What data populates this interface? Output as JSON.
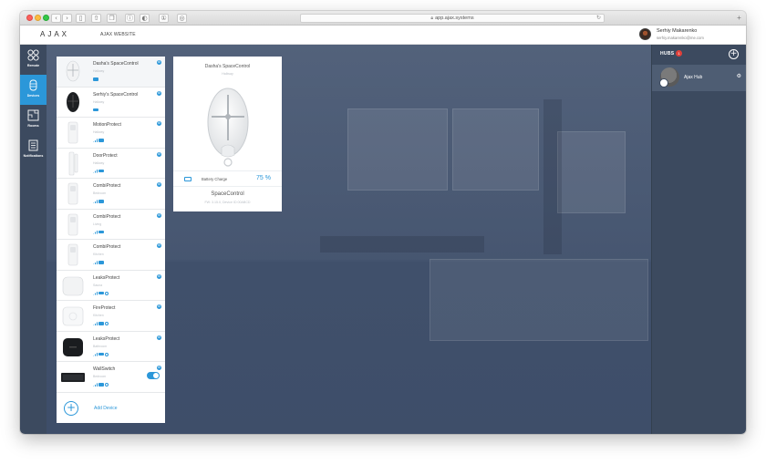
{
  "browser": {
    "url": "app.ajax.systems"
  },
  "header": {
    "logo": "AJAX",
    "website_link": "AJAX WEBSITE",
    "user_name": "Serhiy Makarenko",
    "user_email": "serhiy.makarenko@me.com"
  },
  "sidebar": {
    "items": [
      {
        "label": "Remote",
        "icon": "remote-icon"
      },
      {
        "label": "Devices",
        "icon": "devices-icon"
      },
      {
        "label": "Rooms",
        "icon": "rooms-icon"
      },
      {
        "label": "Notifications",
        "icon": "notifications-icon"
      }
    ]
  },
  "devices": [
    {
      "name": "Dasha's SpaceControl",
      "room": "Hallway",
      "type": "keyfob-white"
    },
    {
      "name": "Serhiy's SpaceControl",
      "room": "Hallway",
      "type": "keyfob-black"
    },
    {
      "name": "MotionProtect",
      "room": "Hallway",
      "type": "motion"
    },
    {
      "name": "DoorProtect",
      "room": "Hallway",
      "type": "door"
    },
    {
      "name": "CombiProtect",
      "room": "Bedroom",
      "type": "motion"
    },
    {
      "name": "CombiProtect",
      "room": "Living",
      "type": "motion"
    },
    {
      "name": "CombiProtect",
      "room": "Kitchen",
      "type": "motion"
    },
    {
      "name": "LeaksProtect",
      "room": "Sauna",
      "type": "leak-white"
    },
    {
      "name": "FireProtect",
      "room": "Kitchen",
      "type": "fire"
    },
    {
      "name": "LeaksProtect",
      "room": "Bathroom",
      "type": "leak-black"
    },
    {
      "name": "WallSwitch",
      "room": "Bedroom",
      "type": "switch"
    }
  ],
  "add_device_label": "Add Device",
  "detail": {
    "title": "Dasha's SpaceControl",
    "room": "Hallway",
    "battery_label": "Battery Charge",
    "battery_value": "75 %",
    "model": "SpaceControl",
    "info": "FW: 3.15.0, Device ID 00ABCD"
  },
  "hubs": {
    "title": "HUBS",
    "count": "1",
    "items": [
      {
        "name": "Ajax Hub"
      }
    ]
  },
  "colors": {
    "accent": "#2b97d9",
    "sidebar": "#3c4a5f",
    "badge": "#e0403a"
  }
}
